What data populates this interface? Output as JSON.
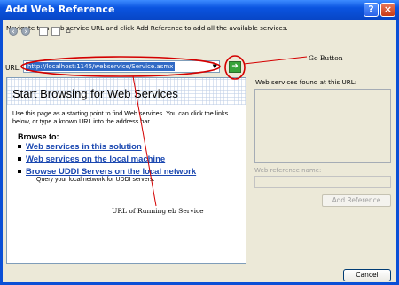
{
  "window": {
    "title": "Add Web Reference",
    "help_label": "?",
    "close_label": "×"
  },
  "instruction": "Navigate to a web service URL and click Add Reference to add all the available services.",
  "url_bar": {
    "label": "URL:",
    "value": "http://localhost:1145/webservice/Service.asmx"
  },
  "browser": {
    "title": "Start Browsing for Web Services",
    "description": "Use this page as a starting point to find Web services. You can click the links below, or type a known URL into the address bar.",
    "browse_to": "Browse to:",
    "links": [
      "Web services in this solution",
      "Web services on the local machine",
      "Browse UDDI Servers on the local network"
    ],
    "uddi_description": "Query your local network for UDDI servers."
  },
  "right_panel": {
    "found_label": "Web services found at this URL:",
    "reference_name_label": "Web reference name:",
    "add_reference_label": "Add Reference"
  },
  "cancel_label": "Cancel",
  "annotations": {
    "go_button": "Go Button",
    "url_service": "URL of Running eb Service"
  },
  "colors": {
    "title_bar": "#0a54e0",
    "link": "#1a47b0",
    "annotation_red": "#d40000",
    "url_highlight": "#316ac5"
  }
}
